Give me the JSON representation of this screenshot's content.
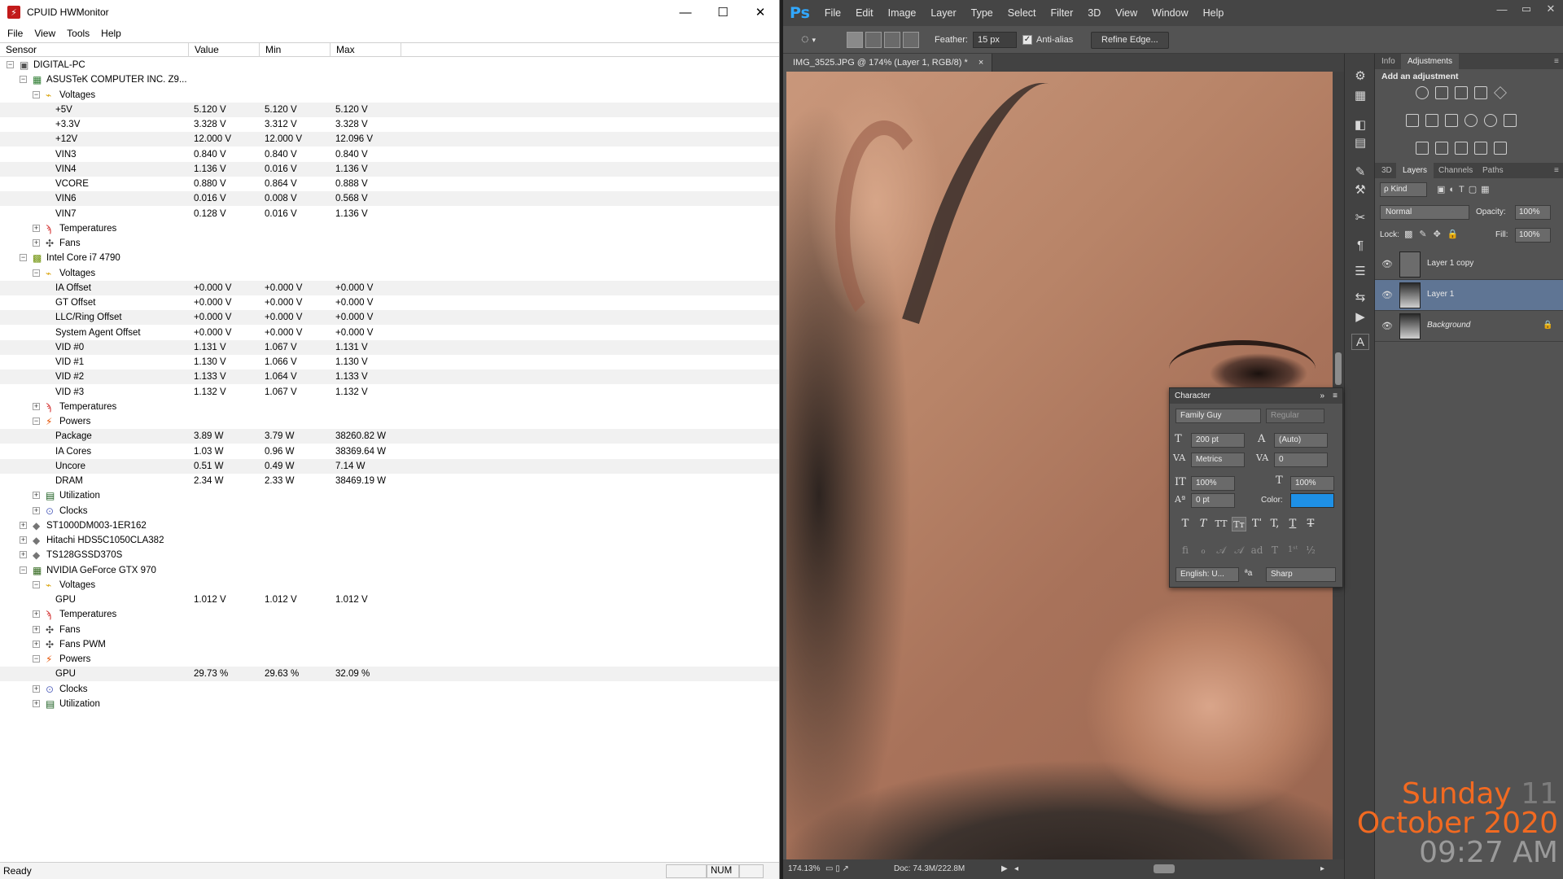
{
  "hw": {
    "title": "CPUID HWMonitor",
    "win_minimize": "—",
    "win_maximize": "☐",
    "win_close": "✕",
    "menu": [
      "File",
      "View",
      "Tools",
      "Help"
    ],
    "columns": [
      "Sensor",
      "Value",
      "Min",
      "Max"
    ],
    "rows": [
      {
        "level": 0,
        "exp": "−",
        "icon": "pc",
        "label": "DIGITAL-PC",
        "value": "",
        "min": "",
        "max": ""
      },
      {
        "level": 1,
        "exp": "−",
        "icon": "mobo",
        "label": "ASUSTeK COMPUTER INC. Z9...",
        "value": "",
        "min": "",
        "max": ""
      },
      {
        "level": 2,
        "exp": "−",
        "icon": "volt",
        "label": "Voltages",
        "value": "",
        "min": "",
        "max": ""
      },
      {
        "level": 3,
        "exp": "",
        "icon": "",
        "label": "+5V",
        "value": "5.120 V",
        "min": "5.120 V",
        "max": "5.120 V"
      },
      {
        "level": 3,
        "exp": "",
        "icon": "",
        "label": "+3.3V",
        "value": "3.328 V",
        "min": "3.312 V",
        "max": "3.328 V"
      },
      {
        "level": 3,
        "exp": "",
        "icon": "",
        "label": "+12V",
        "value": "12.000 V",
        "min": "12.000 V",
        "max": "12.096 V"
      },
      {
        "level": 3,
        "exp": "",
        "icon": "",
        "label": "VIN3",
        "value": "0.840 V",
        "min": "0.840 V",
        "max": "0.840 V"
      },
      {
        "level": 3,
        "exp": "",
        "icon": "",
        "label": "VIN4",
        "value": "1.136 V",
        "min": "0.016 V",
        "max": "1.136 V"
      },
      {
        "level": 3,
        "exp": "",
        "icon": "",
        "label": "VCORE",
        "value": "0.880 V",
        "min": "0.864 V",
        "max": "0.888 V"
      },
      {
        "level": 3,
        "exp": "",
        "icon": "",
        "label": "VIN6",
        "value": "0.016 V",
        "min": "0.008 V",
        "max": "0.568 V"
      },
      {
        "level": 3,
        "exp": "",
        "icon": "",
        "label": "VIN7",
        "value": "0.128 V",
        "min": "0.016 V",
        "max": "1.136 V"
      },
      {
        "level": 2,
        "exp": "+",
        "icon": "temp",
        "label": "Temperatures",
        "value": "",
        "min": "",
        "max": ""
      },
      {
        "level": 2,
        "exp": "+",
        "icon": "fan",
        "label": "Fans",
        "value": "",
        "min": "",
        "max": ""
      },
      {
        "level": 1,
        "exp": "−",
        "icon": "cpu",
        "label": "Intel Core i7 4790",
        "value": "",
        "min": "",
        "max": ""
      },
      {
        "level": 2,
        "exp": "−",
        "icon": "volt",
        "label": "Voltages",
        "value": "",
        "min": "",
        "max": ""
      },
      {
        "level": 3,
        "exp": "",
        "icon": "",
        "label": "IA Offset",
        "value": "+0.000 V",
        "min": "+0.000 V",
        "max": "+0.000 V"
      },
      {
        "level": 3,
        "exp": "",
        "icon": "",
        "label": "GT Offset",
        "value": "+0.000 V",
        "min": "+0.000 V",
        "max": "+0.000 V"
      },
      {
        "level": 3,
        "exp": "",
        "icon": "",
        "label": "LLC/Ring Offset",
        "value": "+0.000 V",
        "min": "+0.000 V",
        "max": "+0.000 V"
      },
      {
        "level": 3,
        "exp": "",
        "icon": "",
        "label": "System Agent Offset",
        "value": "+0.000 V",
        "min": "+0.000 V",
        "max": "+0.000 V"
      },
      {
        "level": 3,
        "exp": "",
        "icon": "",
        "label": "VID #0",
        "value": "1.131 V",
        "min": "1.067 V",
        "max": "1.131 V"
      },
      {
        "level": 3,
        "exp": "",
        "icon": "",
        "label": "VID #1",
        "value": "1.130 V",
        "min": "1.066 V",
        "max": "1.130 V"
      },
      {
        "level": 3,
        "exp": "",
        "icon": "",
        "label": "VID #2",
        "value": "1.133 V",
        "min": "1.064 V",
        "max": "1.133 V"
      },
      {
        "level": 3,
        "exp": "",
        "icon": "",
        "label": "VID #3",
        "value": "1.132 V",
        "min": "1.067 V",
        "max": "1.132 V"
      },
      {
        "level": 2,
        "exp": "+",
        "icon": "temp",
        "label": "Temperatures",
        "value": "",
        "min": "",
        "max": ""
      },
      {
        "level": 2,
        "exp": "−",
        "icon": "power",
        "label": "Powers",
        "value": "",
        "min": "",
        "max": ""
      },
      {
        "level": 3,
        "exp": "",
        "icon": "",
        "label": "Package",
        "value": "3.89 W",
        "min": "3.79 W",
        "max": "38260.82 W"
      },
      {
        "level": 3,
        "exp": "",
        "icon": "",
        "label": "IA Cores",
        "value": "1.03 W",
        "min": "0.96 W",
        "max": "38369.64 W"
      },
      {
        "level": 3,
        "exp": "",
        "icon": "",
        "label": "Uncore",
        "value": "0.51 W",
        "min": "0.49 W",
        "max": "7.14 W"
      },
      {
        "level": 3,
        "exp": "",
        "icon": "",
        "label": "DRAM",
        "value": "2.34 W",
        "min": "2.33 W",
        "max": "38469.19 W"
      },
      {
        "level": 2,
        "exp": "+",
        "icon": "util",
        "label": "Utilization",
        "value": "",
        "min": "",
        "max": ""
      },
      {
        "level": 2,
        "exp": "+",
        "icon": "clock",
        "label": "Clocks",
        "value": "",
        "min": "",
        "max": ""
      },
      {
        "level": 1,
        "exp": "+",
        "icon": "hdd",
        "label": "ST1000DM003-1ER162",
        "value": "",
        "min": "",
        "max": ""
      },
      {
        "level": 1,
        "exp": "+",
        "icon": "hdd",
        "label": "Hitachi HDS5C1050CLA382",
        "value": "",
        "min": "",
        "max": ""
      },
      {
        "level": 1,
        "exp": "+",
        "icon": "hdd",
        "label": "TS128GSSD370S",
        "value": "",
        "min": "",
        "max": ""
      },
      {
        "level": 1,
        "exp": "−",
        "icon": "gpu",
        "label": "NVIDIA GeForce GTX 970",
        "value": "",
        "min": "",
        "max": ""
      },
      {
        "level": 2,
        "exp": "−",
        "icon": "volt",
        "label": "Voltages",
        "value": "",
        "min": "",
        "max": ""
      },
      {
        "level": 3,
        "exp": "",
        "icon": "",
        "label": "GPU",
        "value": "1.012 V",
        "min": "1.012 V",
        "max": "1.012 V"
      },
      {
        "level": 2,
        "exp": "+",
        "icon": "temp",
        "label": "Temperatures",
        "value": "",
        "min": "",
        "max": ""
      },
      {
        "level": 2,
        "exp": "+",
        "icon": "fan",
        "label": "Fans",
        "value": "",
        "min": "",
        "max": ""
      },
      {
        "level": 2,
        "exp": "+",
        "icon": "fan",
        "label": "Fans PWM",
        "value": "",
        "min": "",
        "max": ""
      },
      {
        "level": 2,
        "exp": "−",
        "icon": "power",
        "label": "Powers",
        "value": "",
        "min": "",
        "max": ""
      },
      {
        "level": 3,
        "exp": "",
        "icon": "",
        "label": "GPU",
        "value": "29.73 %",
        "min": "29.63 %",
        "max": "32.09 %"
      },
      {
        "level": 2,
        "exp": "+",
        "icon": "clock",
        "label": "Clocks",
        "value": "",
        "min": "",
        "max": ""
      },
      {
        "level": 2,
        "exp": "+",
        "icon": "util",
        "label": "Utilization",
        "value": "",
        "min": "",
        "max": ""
      }
    ],
    "status": {
      "text": "Ready",
      "num": "NUM"
    }
  },
  "ps": {
    "logo": "Ps",
    "menu": [
      "File",
      "Edit",
      "Image",
      "Layer",
      "Type",
      "Select",
      "Filter",
      "3D",
      "View",
      "Window",
      "Help"
    ],
    "options": {
      "feather_label": "Feather:",
      "feather_value": "15 px",
      "antialias_label": "Anti-alias",
      "refine_edge": "Refine Edge..."
    },
    "doc_tab": "IMG_3525.JPG @ 174% (Layer 1, RGB/8) *",
    "doc_tab_close": "×",
    "status": {
      "zoom": "174.13%",
      "doc": "Doc: 74.3M/222.8M"
    },
    "panels": {
      "top_tabs": [
        "Info",
        "Adjustments"
      ],
      "adjust_title": "Add an adjustment",
      "layer_tabs": [
        "3D",
        "Layers",
        "Channels",
        "Paths"
      ],
      "kind": "ρ Kind",
      "blend_mode": "Normal",
      "opacity_label": "Opacity:",
      "opacity_value": "100%",
      "lock_label": "Lock:",
      "fill_label": "Fill:",
      "fill_value": "100%",
      "layers": [
        "Layer 1 copy",
        "Layer 1",
        "Background"
      ]
    },
    "character": {
      "title": "Character",
      "font_family": "Family Guy",
      "font_style": "Regular",
      "size": "200 pt",
      "leading": "(Auto)",
      "kerning": "Metrics",
      "tracking": "0",
      "vscale": "100%",
      "hscale": "100%",
      "baseline": "0 pt",
      "color_label": "Color:",
      "color_value": "#1e90e6",
      "language": "English: U...",
      "aa_label": "a",
      "antialias": "Sharp"
    }
  },
  "clock": {
    "day": "Sunday",
    "date_num": "11",
    "month_year": "October 2020",
    "time": "09:27 AM"
  }
}
